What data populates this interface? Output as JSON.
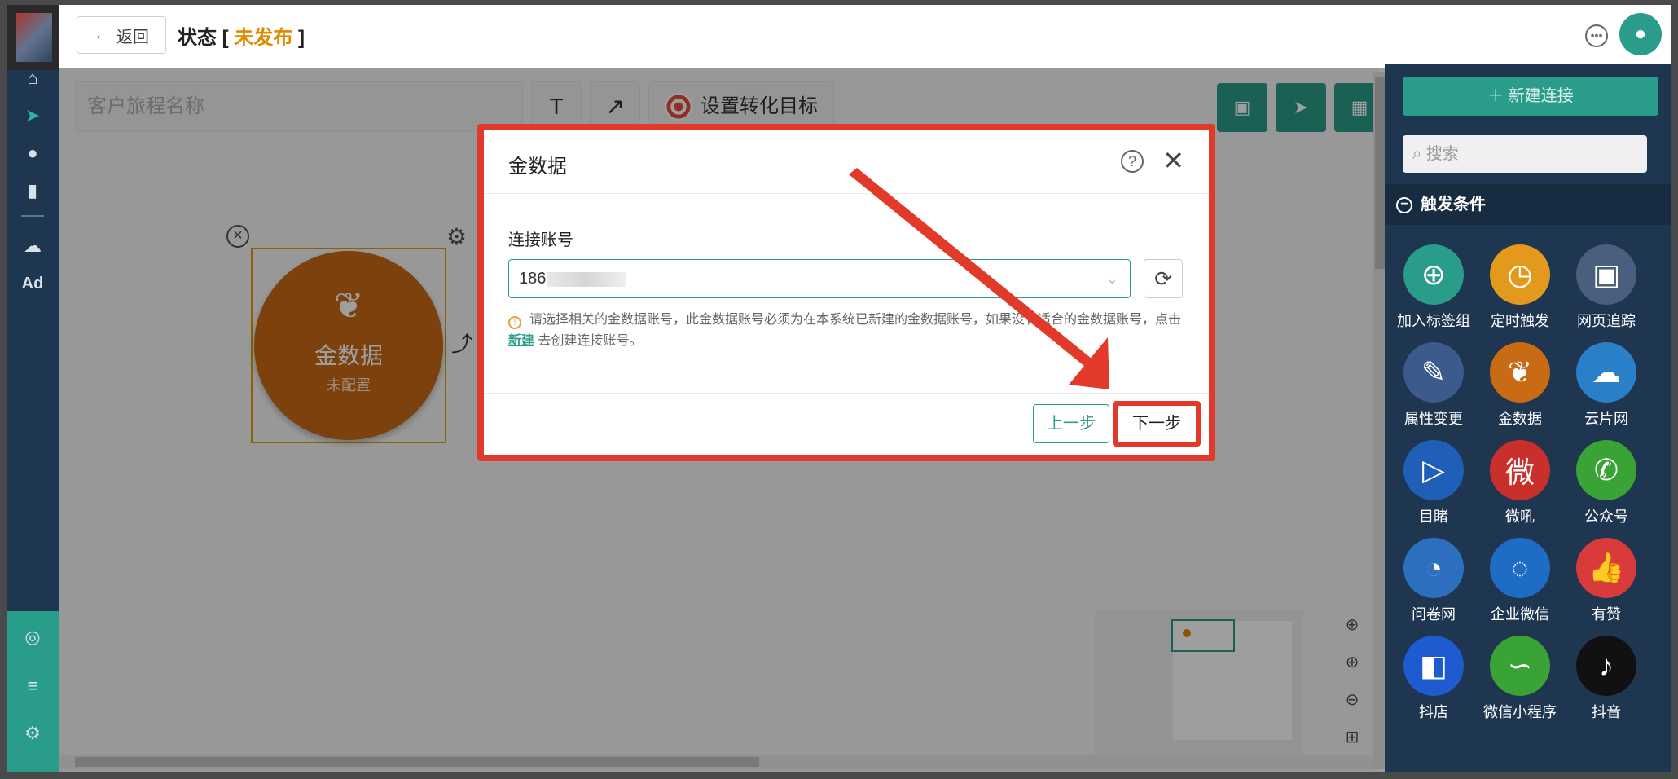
{
  "topbar": {
    "back_label": "返回",
    "state_prefix": "状态 [ ",
    "state_value": "未发布",
    "state_suffix": " ]"
  },
  "leftnav": {
    "items": [
      "home",
      "send",
      "user",
      "chart",
      "weather",
      "Ad"
    ]
  },
  "canvas": {
    "name_placeholder": "客户旅程名称",
    "text_tool": "T",
    "arrow_tool": "↗",
    "goal_label": "设置转化目标",
    "node": {
      "title": "金数据",
      "subtitle": "未配置"
    }
  },
  "modal": {
    "title": "金数据",
    "account_label": "连接账号",
    "account_value": "186",
    "hint_text_1": "请选择相关的金数据账号，此金数据账号必须为在本系统已新建的金数据账号，如果没有适合的金数据账号，点击 ",
    "hint_link": "新建",
    "hint_text_2": " 去创建连接账号。",
    "prev_label": "上一步",
    "next_label": "下一步"
  },
  "rightpanel": {
    "new_connection": "＋ 新建连接",
    "search_placeholder": "搜索",
    "section_title": "触发条件",
    "tiles": [
      {
        "label": "加入标签组",
        "icon": "add-user-icon",
        "color": "#2a9c8a"
      },
      {
        "label": "定时触发",
        "icon": "clock-icon",
        "color": "#e39a1c"
      },
      {
        "label": "网页追踪",
        "icon": "web-icon",
        "color": "#4a5f7e"
      },
      {
        "label": "属性变更",
        "icon": "edit-icon",
        "color": "#3c5a8c"
      },
      {
        "label": "金数据",
        "icon": "jinshuju-icon",
        "color": "#c96a15"
      },
      {
        "label": "云片网",
        "icon": "cloud-icon",
        "color": "#2a7fc9"
      },
      {
        "label": "目睹",
        "icon": "play-icon",
        "color": "#1f5fb8"
      },
      {
        "label": "微吼",
        "icon": "weihou-icon",
        "color": "#c9302c"
      },
      {
        "label": "公众号",
        "icon": "wechat-icon",
        "color": "#3aa336"
      },
      {
        "label": "问卷网",
        "icon": "wenjuan-icon",
        "color": "#2c6fbf"
      },
      {
        "label": "企业微信",
        "icon": "wework-icon",
        "color": "#1f6cc7"
      },
      {
        "label": "有赞",
        "icon": "thumb-icon",
        "color": "#d93a3a"
      },
      {
        "label": "抖店",
        "icon": "doudian-icon",
        "color": "#1f5bd0"
      },
      {
        "label": "微信小程序",
        "icon": "miniprogram-icon",
        "color": "#3aa336"
      },
      {
        "label": "抖音",
        "icon": "tiktok-icon",
        "color": "#111111"
      }
    ]
  }
}
